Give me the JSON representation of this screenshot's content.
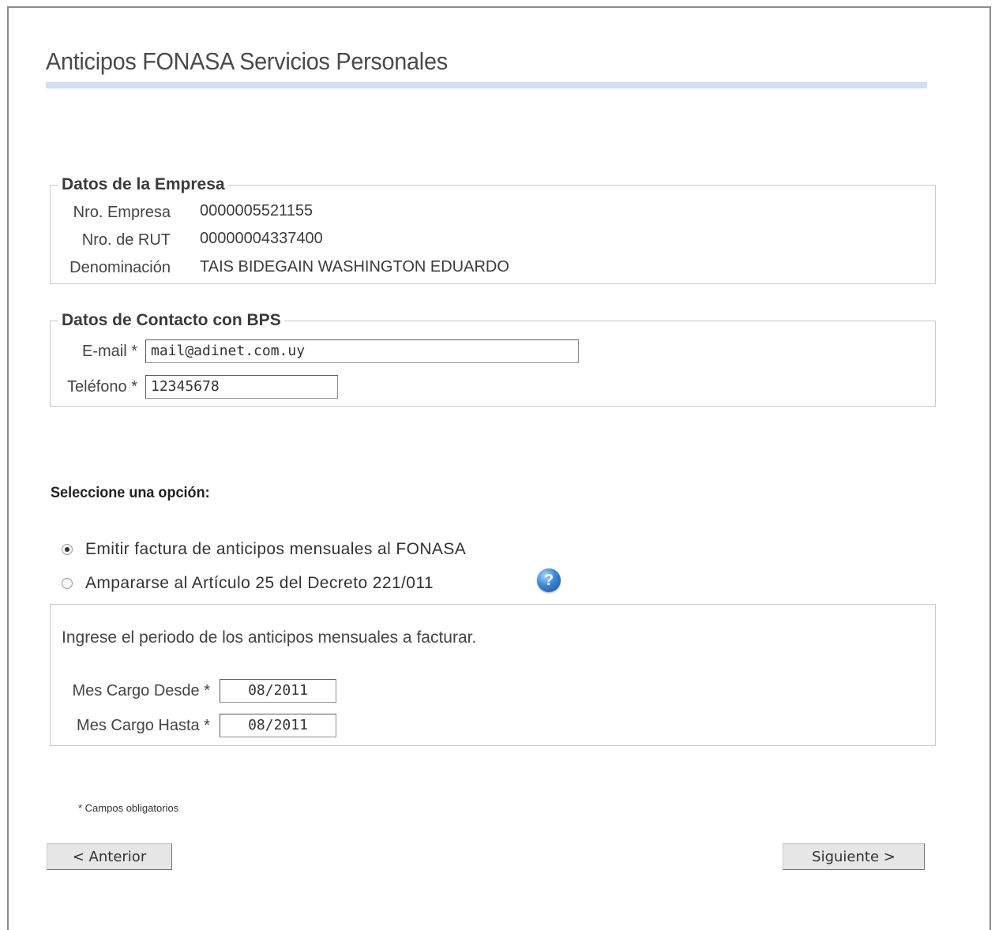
{
  "page": {
    "title": "Anticipos FONASA Servicios Personales"
  },
  "empresa": {
    "legend": "Datos de la Empresa",
    "nro_empresa_label": "Nro. Empresa",
    "nro_empresa_value": "0000005521155",
    "nro_rut_label": "Nro. de RUT",
    "nro_rut_value": "00000004337400",
    "denominacion_label": "Denominación",
    "denominacion_value": "TAIS BIDEGAIN WASHINGTON EDUARDO"
  },
  "contacto": {
    "legend": "Datos de Contacto con BPS",
    "email_label": "E-mail *",
    "email_value": "mail@adinet.com.uy",
    "telefono_label": "Teléfono *",
    "telefono_value": "12345678"
  },
  "opciones": {
    "prompt": "Seleccione una opción:",
    "items": [
      {
        "label": "Emitir factura de anticipos mensuales al FONASA",
        "checked": true
      },
      {
        "label": "Ampararse al Artículo 25 del Decreto 221/011",
        "checked": false
      }
    ],
    "help_icon": "question-circle-icon",
    "help_glyph": "?"
  },
  "periodo": {
    "instruction": "Ingrese el periodo de los anticipos mensuales a facturar.",
    "desde_label": "Mes Cargo Desde *",
    "desde_value": "08/2011",
    "hasta_label": "Mes Cargo Hasta *",
    "hasta_value": "08/2011"
  },
  "footer": {
    "note": "* Campos obligatorios",
    "anterior_label": "< Anterior",
    "siguiente_label": "Siguiente >"
  },
  "colors": {
    "title_bar": "#d2dff0",
    "border": "#c9c9c9",
    "help_icon": "#3b86d6"
  }
}
